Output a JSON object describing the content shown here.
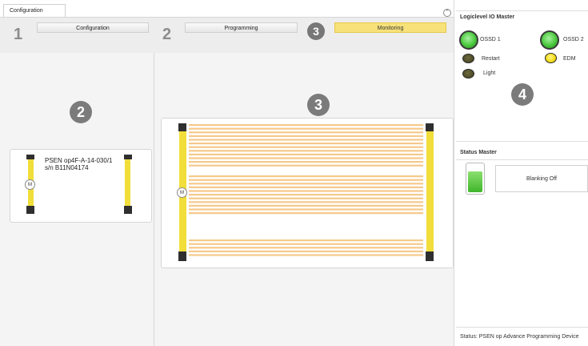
{
  "tab": {
    "label": "Configuration"
  },
  "steps": [
    {
      "number": "1",
      "label": "Configuration"
    },
    {
      "number": "2",
      "label": "Programming"
    },
    {
      "number": "3",
      "label": "Monitoring"
    }
  ],
  "left_panel": {
    "marker": "2",
    "device_name": "PSEN op4F-A-14-030/1",
    "serial": "s/n B11N04174",
    "badge": "M"
  },
  "middle_panel": {
    "marker": "3",
    "badge": "M",
    "beam_groups": [
      12,
      11,
      5
    ]
  },
  "io_master": {
    "title": "Logiclevel IO Master",
    "marker": "4",
    "ossd1": "OSSD 1",
    "ossd2": "OSSD 2",
    "restart": "Restart",
    "edm": "EDM",
    "light": "Light"
  },
  "status_master": {
    "title": "Status Master",
    "blanking": "Blanking Off",
    "battery_level": 0.75
  },
  "footer": {
    "status": "Status: PSEN op Advance Programming Device"
  },
  "colors": {
    "accent": "#f7e27a",
    "beam": "#f6c98a",
    "bar": "#f1de3a",
    "led_green": "#49c83c"
  }
}
